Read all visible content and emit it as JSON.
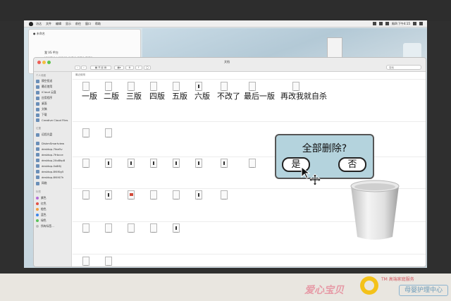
{
  "menubar": {
    "items": [
      "访达",
      "文件",
      "编辑",
      "显示",
      "前往",
      "窗口",
      "帮助"
    ],
    "clock": "周四 下午4:15"
  },
  "note_window": {
    "title": "● 未命名",
    "line1": "我 VS 甲方",
    "line2": "知道了什么叫做\"你做我永远看你看看\"。"
  },
  "finder": {
    "title": "文档",
    "crumb": "最近使用",
    "search_placeholder": "搜索",
    "sidebar": {
      "favorites_header": "个人收藏",
      "favorites": [
        "隔空投送",
        "最近使用",
        "iCloud 云盘",
        "应用程序",
        "桌面",
        "文稿",
        "下载",
        "Creative Cloud Files"
      ],
      "locations_header": "位置",
      "locations": [
        "远程光盘"
      ],
      "devices": [
        "DiskmSmartview",
        "desktop-7fae5v",
        "desktop-7frbcce",
        "desktop-20o8kp8",
        "desktop-0s6l6j",
        "desktop-8f4f0g5",
        "desktop-8f4f47h",
        "网络"
      ],
      "tags_header": "标签",
      "tags": [
        {
          "label": "紫色",
          "color": "#b36bd6"
        },
        {
          "label": "红色",
          "color": "#e25247"
        },
        {
          "label": "橙色",
          "color": "#f2a03c"
        },
        {
          "label": "蓝色",
          "color": "#3d86e8"
        },
        {
          "label": "绿色",
          "color": "#59c35a"
        },
        {
          "label": "所有标签...",
          "color": "#bdbdbd"
        }
      ]
    },
    "folders": [
      "一版",
      "二版",
      "三版",
      "四版",
      "五版",
      "六版",
      "不改了",
      "最后一版",
      "再改我就自杀"
    ]
  },
  "dialog": {
    "question": "全部删除?",
    "yes": "是",
    "no": "否"
  },
  "brand": {
    "name": "爱心宝贝",
    "tm": "TM 高端家庭服务",
    "sub": "母婴护理中心"
  }
}
